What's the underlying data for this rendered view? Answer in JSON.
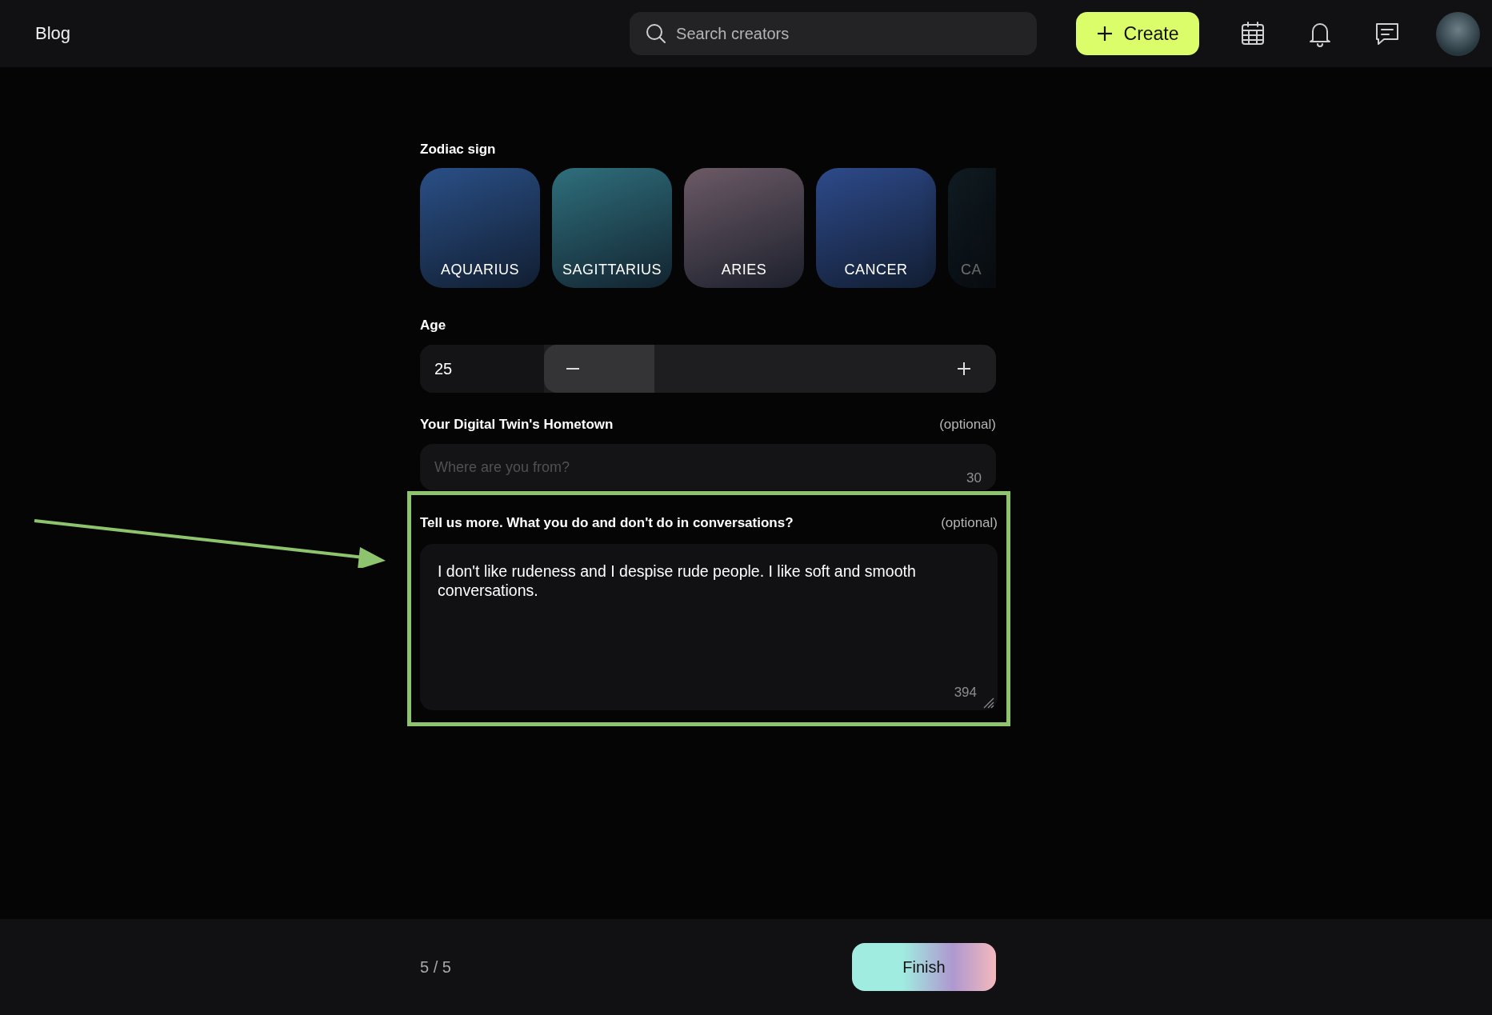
{
  "header": {
    "logo": "Blog",
    "search": {
      "placeholder": "Search creators"
    },
    "create_button": "Create"
  },
  "zodiac": {
    "label": "Zodiac sign",
    "signs": [
      {
        "name": "AQUARIUS"
      },
      {
        "name": "SAGITTARIUS"
      },
      {
        "name": "ARIES"
      },
      {
        "name": "CANCER"
      },
      {
        "name": "CA"
      }
    ]
  },
  "age": {
    "label": "Age",
    "value": "25"
  },
  "hometown": {
    "label": "Your Digital Twin's Hometown",
    "optional": "(optional)",
    "placeholder": "Where are you from?",
    "counter": "30"
  },
  "conversations": {
    "label": "Tell us more. What you do and don't do in conversations?",
    "optional": "(optional)",
    "value": "I don't like rudeness and I despise rude people. I like soft and smooth conversations.",
    "counter": "394"
  },
  "footer": {
    "step": "5 / 5",
    "finish_button": "Finish"
  }
}
